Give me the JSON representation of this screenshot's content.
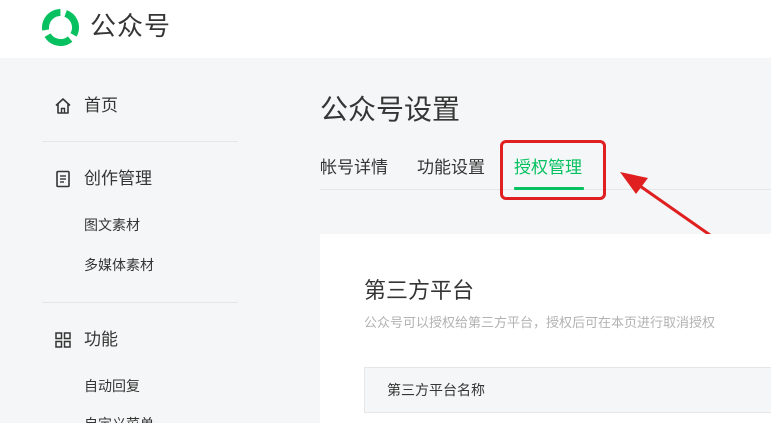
{
  "header": {
    "brand": "公众号"
  },
  "sidebar": {
    "home": {
      "label": "首页",
      "icon": "home-icon"
    },
    "creation": {
      "label": "创作管理",
      "icon": "document-icon",
      "items": [
        "图文素材",
        "多媒体素材"
      ]
    },
    "features": {
      "label": "功能",
      "icon": "grid-icon",
      "items": [
        "自动回复",
        "自定义菜单"
      ]
    }
  },
  "main": {
    "title": "公众号设置",
    "tabs": [
      {
        "label": "帐号详情"
      },
      {
        "label": "功能设置"
      },
      {
        "label": "授权管理",
        "active": true
      }
    ],
    "card": {
      "title": "第三方平台",
      "description": "公众号可以授权给第三方平台，授权后可在本页进行取消授权",
      "table_header": "第三方平台名称"
    }
  },
  "colors": {
    "accent": "#07c160",
    "annotation": "#e02020",
    "background": "#f5f6f7"
  }
}
